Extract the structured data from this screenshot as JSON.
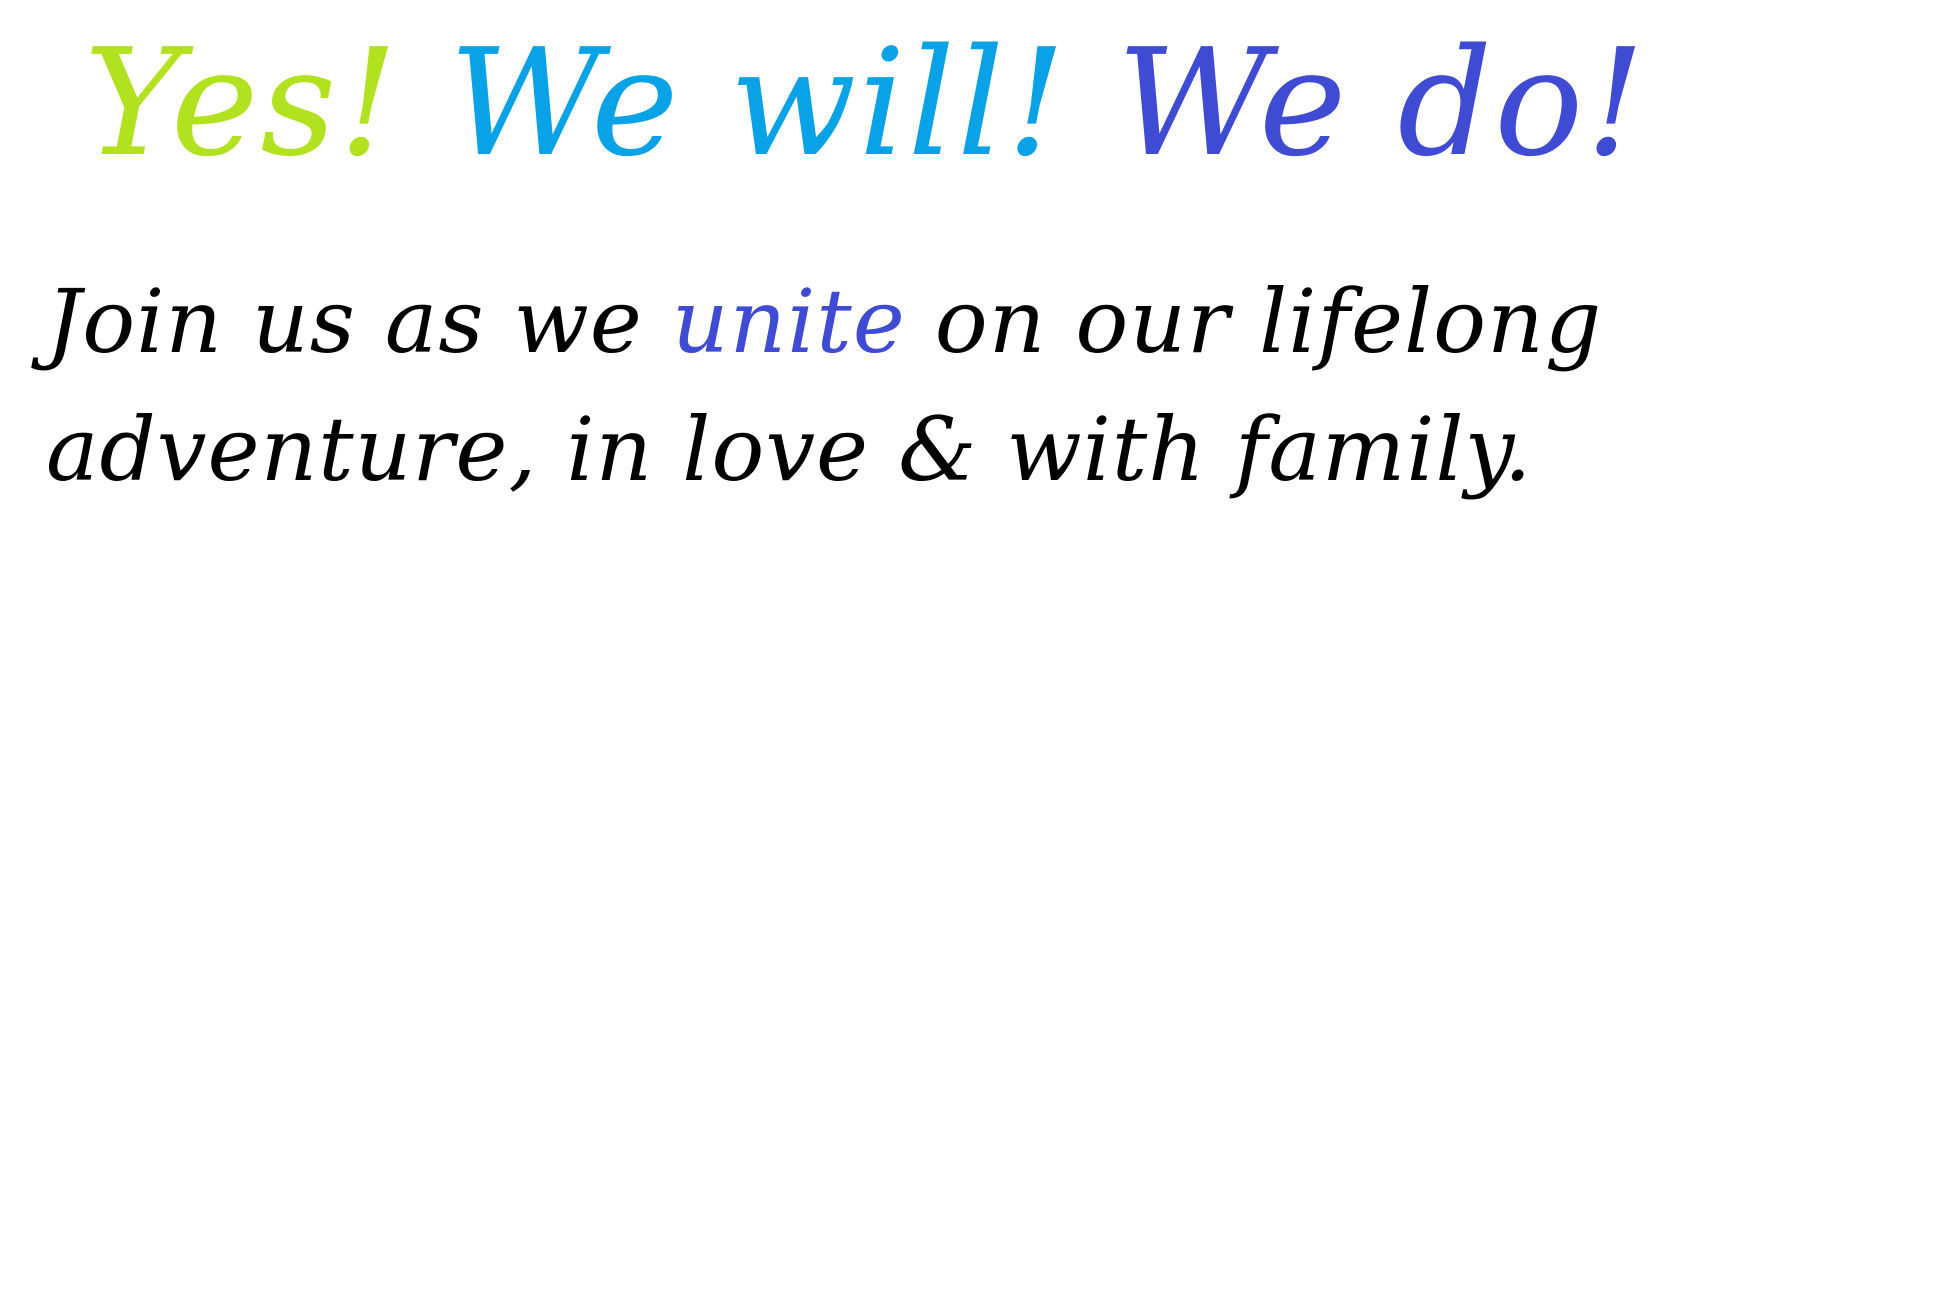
{
  "headline": {
    "part1": "Yes!",
    "part2": "We will!",
    "part3": "We do!"
  },
  "message": {
    "line1_before": "Join us as we ",
    "line1_accent": "unite",
    "line1_after": " on our lifelong",
    "line2": "adventure, in love & with family."
  },
  "colors": {
    "lime": "#b2e21f",
    "sky_blue": "#0aa2e6",
    "indigo": "#3f4bd3",
    "text": "#000000",
    "background": "#ffffff"
  }
}
